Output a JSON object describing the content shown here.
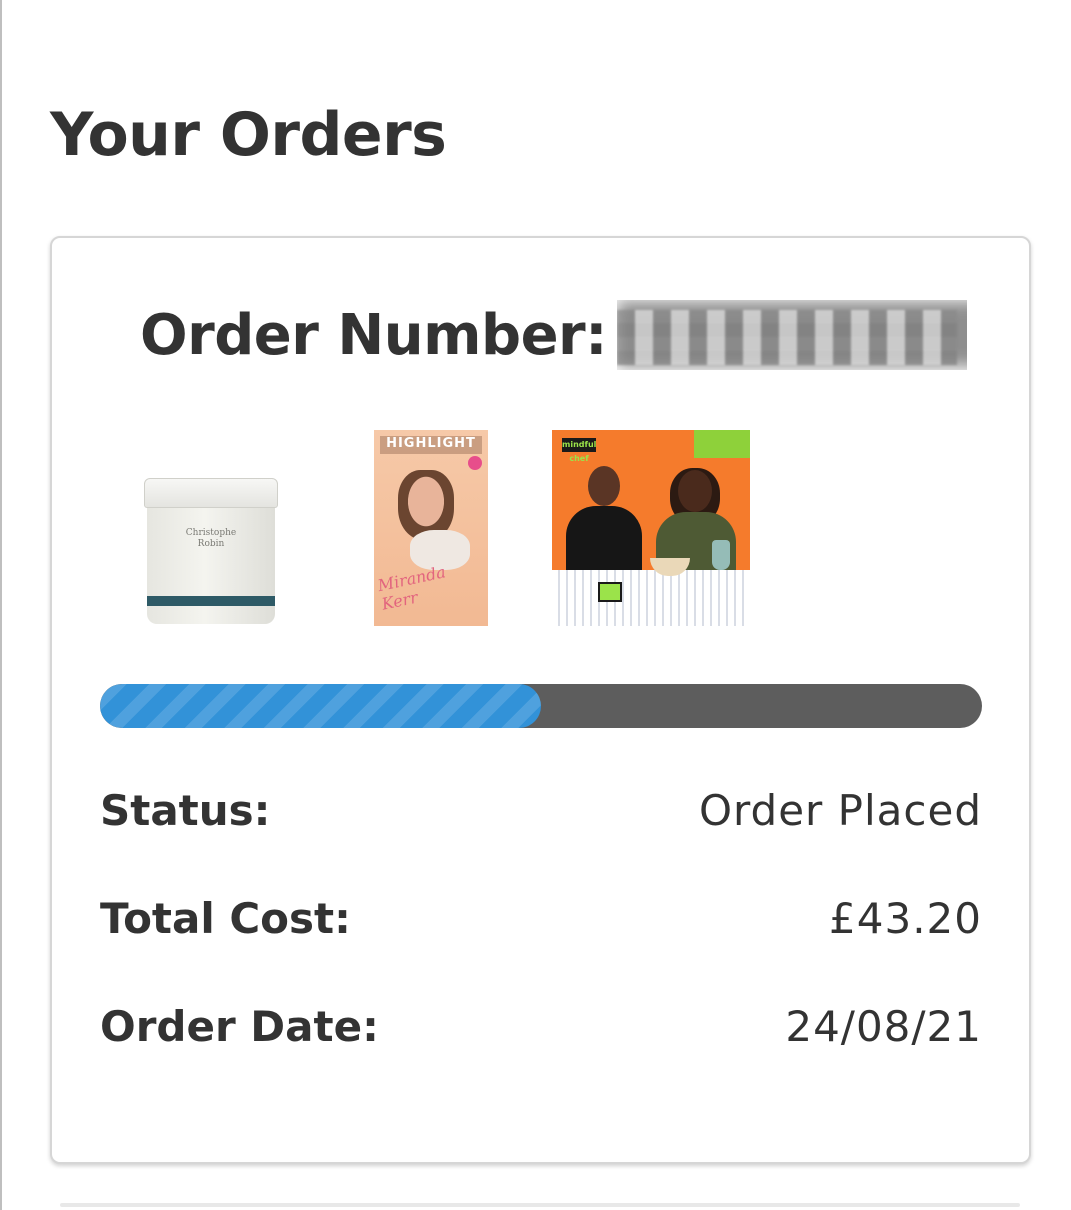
{
  "page": {
    "title": "Your Orders"
  },
  "order": {
    "number_label": "Order Number:",
    "number_value": "██████████",
    "items": [
      {
        "icon": "cream-jar-product-image",
        "jar_text": "Christophe Robin"
      },
      {
        "icon": "magazine-cover-product-image",
        "masthead": "HIGHLIGHT",
        "script": "Miranda Kerr"
      },
      {
        "icon": "meal-kit-photo-product-image",
        "logo": "mindful chef"
      }
    ],
    "progress": {
      "fraction": 0.5,
      "color": "#3292d8",
      "track_color": "#5d5d5d"
    },
    "status": {
      "label": "Status:",
      "value": "Order Placed"
    },
    "total": {
      "label": "Total Cost:",
      "value": "£43.20"
    },
    "date": {
      "label": "Order Date:",
      "value": "24/08/21"
    }
  },
  "colors": {
    "text": "#333333",
    "card_border": "#d6d6d6",
    "accent": "#3292d8"
  }
}
